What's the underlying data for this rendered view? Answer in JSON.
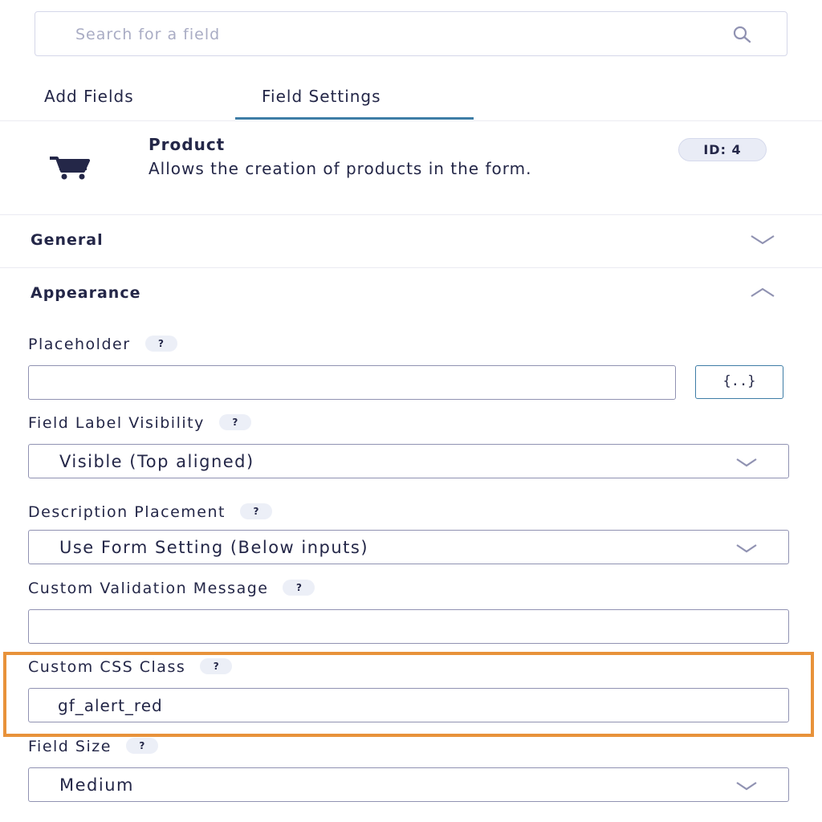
{
  "search": {
    "placeholder": "Search for a field",
    "icon": "search-icon"
  },
  "tabs": [
    {
      "label": "Add Fields",
      "active": false
    },
    {
      "label": "Field Settings",
      "active": true
    }
  ],
  "field": {
    "icon": "shopping-cart-icon",
    "title": "Product",
    "description": "Allows the creation of products in the form.",
    "id_badge": "ID: 4"
  },
  "sections": {
    "general": {
      "title": "General",
      "expanded": false
    },
    "appearance": {
      "title": "Appearance",
      "expanded": true
    }
  },
  "settings": {
    "placeholder": {
      "label": "Placeholder",
      "help": "?",
      "value": "",
      "merge_tag_button": "{..}"
    },
    "label_visibility": {
      "label": "Field Label Visibility",
      "help": "?",
      "value": "Visible (Top aligned)"
    },
    "description_placement": {
      "label": "Description Placement",
      "help": "?",
      "value": "Use Form Setting (Below inputs)"
    },
    "validation_message": {
      "label": "Custom Validation Message",
      "help": "?",
      "value": ""
    },
    "css_class": {
      "label": "Custom CSS Class",
      "help": "?",
      "value": "gf_alert_red",
      "highlighted": true
    },
    "field_size": {
      "label": "Field Size",
      "help": "?",
      "value": "Medium"
    }
  },
  "colors": {
    "accent": "#3e7da6",
    "highlight": "#e8923a",
    "text": "#242748"
  }
}
